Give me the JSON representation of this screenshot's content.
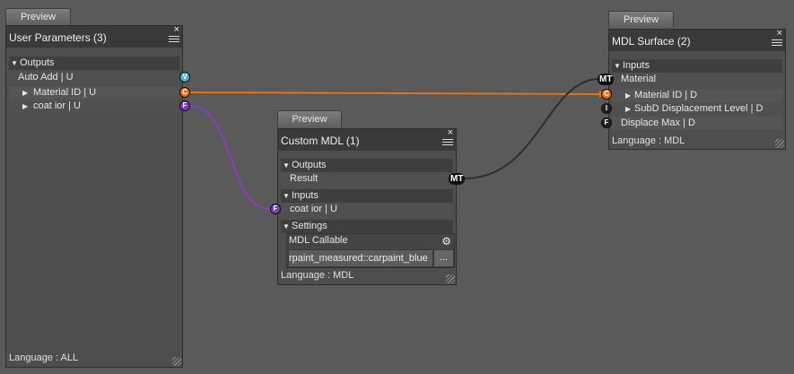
{
  "colors": {
    "canvas": "#5a5a5a",
    "node_bg": "#4e4e4e",
    "header_bg": "#3a3a3a",
    "orange_wire": "#e2731a",
    "purple_wire": "#8c3cc0",
    "dark_wire": "#2e2e2e",
    "port_v": "#4ab3d6",
    "port_c": "#e2731a",
    "port_f": "#7a3bc4",
    "port_i": "#222222"
  },
  "preview_label": "Preview",
  "close_glyph": "×",
  "user_params": {
    "title": "User Parameters (3)",
    "section_outputs": "Outputs",
    "items": [
      "Auto Add  | U",
      "Material ID  | U",
      "coat ior  | U"
    ],
    "ports": [
      "V",
      "C",
      "F"
    ],
    "footer": "Language : ALL"
  },
  "custom_mdl": {
    "title": "Custom MDL (1)",
    "section_outputs": "Outputs",
    "result": "Result",
    "result_port": "MT",
    "section_inputs": "Inputs",
    "input_coat": "coat ior  | U",
    "input_port": "F",
    "section_settings": "Settings",
    "callable_label": "MDL Callable",
    "callable_value": "rpaint_measured::carpaint_blue",
    "ellipsis": "...",
    "footer": "Language : MDL"
  },
  "mdl_surface": {
    "title": "MDL Surface (2)",
    "section_inputs": "Inputs",
    "material": "Material",
    "material_port": "MT",
    "material_id": "Material ID  | D",
    "subd": "SubD Displacement Level  | D",
    "displace": "Displace Max  | D",
    "ports": [
      "C",
      "I",
      "F"
    ],
    "footer": "Language : MDL"
  }
}
